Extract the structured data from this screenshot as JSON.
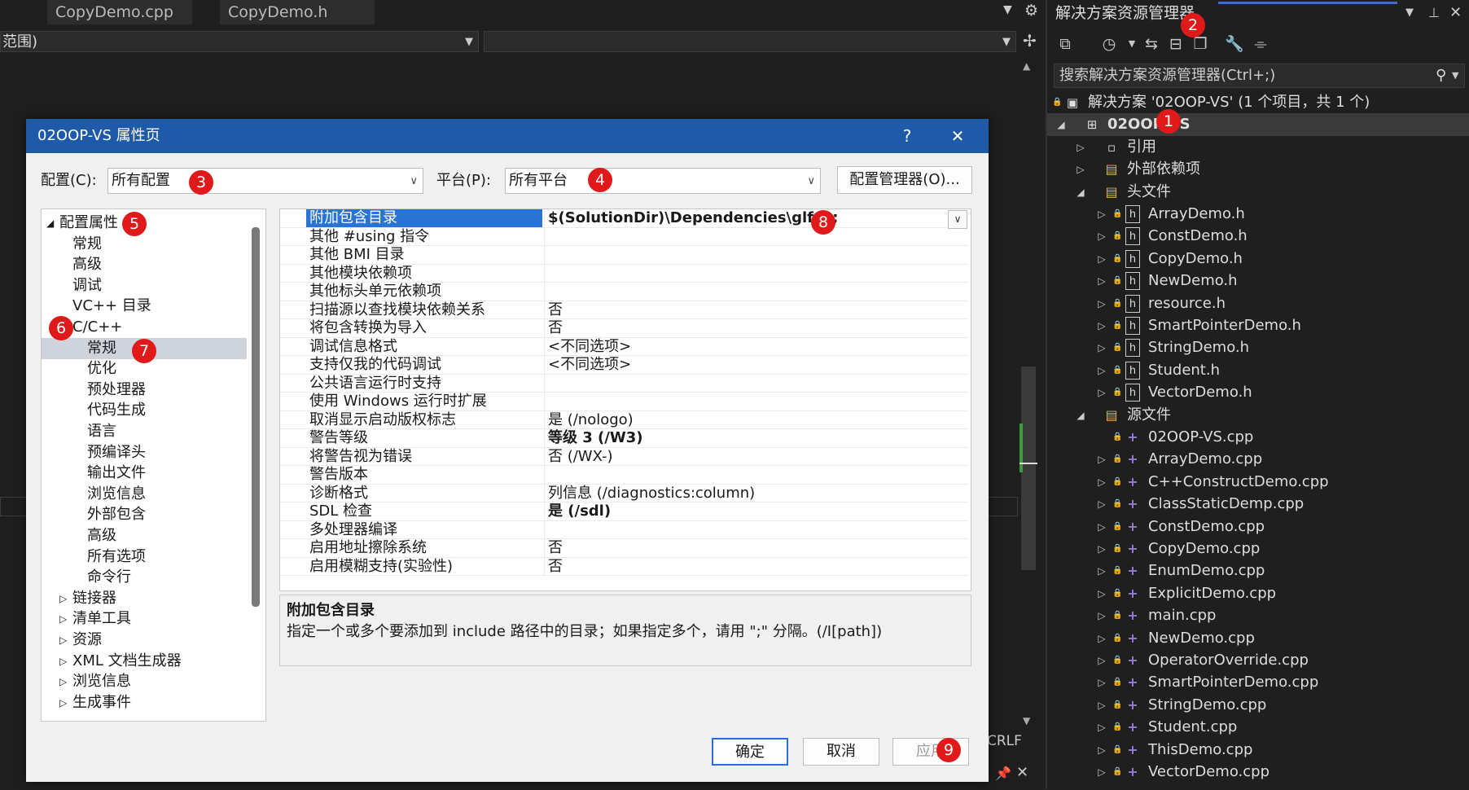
{
  "editor": {
    "tabs": [
      "CopyDemo.cpp",
      "CopyDemo.h"
    ],
    "nav_scope": "范围)",
    "crlf": "CRLF"
  },
  "solution_explorer": {
    "title": "解决方案资源管理器",
    "search_placeholder": "搜索解决方案资源管理器(Ctrl+;)",
    "solution_label": "解决方案 '02OOP-VS' (1 个项目，共 1 个)",
    "project": "02OOP-VS",
    "references": "引用",
    "external_deps": "外部依赖项",
    "headers_folder": "头文件",
    "headers": [
      "ArrayDemo.h",
      "ConstDemo.h",
      "CopyDemo.h",
      "NewDemo.h",
      "resource.h",
      "SmartPointerDemo.h",
      "StringDemo.h",
      "Student.h",
      "VectorDemo.h"
    ],
    "sources_folder": "源文件",
    "sources": [
      "02OOP-VS.cpp",
      "ArrayDemo.cpp",
      "C++ConstructDemo.cpp",
      "ClassStaticDemp.cpp",
      "ConstDemo.cpp",
      "CopyDemo.cpp",
      "EnumDemo.cpp",
      "ExplicitDemo.cpp",
      "main.cpp",
      "NewDemo.cpp",
      "OperatorOverride.cpp",
      "SmartPointerDemo.cpp",
      "StringDemo.cpp",
      "Student.cpp",
      "ThisDemo.cpp",
      "VectorDemo.cpp"
    ]
  },
  "dialog": {
    "title": "02OOP-VS 属性页",
    "help": "?",
    "close": "✕",
    "config_label": "配置(C):",
    "config_value": "所有配置",
    "platform_label": "平台(P):",
    "platform_value": "所有平台",
    "config_manager": "配置管理器(O)...",
    "tree": {
      "root": "配置属性",
      "items": [
        "常规",
        "高级",
        "调试",
        "VC++ 目录"
      ],
      "cpp": "C/C++",
      "cpp_children": [
        "常规",
        "优化",
        "预处理器",
        "代码生成",
        "语言",
        "预编译头",
        "输出文件",
        "浏览信息",
        "外部包含",
        "高级",
        "所有选项",
        "命令行"
      ],
      "collapsed": [
        "链接器",
        "清单工具",
        "资源",
        "XML 文档生成器",
        "浏览信息",
        "生成事件"
      ]
    },
    "properties": [
      {
        "name": "附加包含目录",
        "value": "$(SolutionDir)\\Dependencies\\glfw\\;"
      },
      {
        "name": "其他 #using 指令",
        "value": ""
      },
      {
        "name": "其他 BMI 目录",
        "value": ""
      },
      {
        "name": "其他模块依赖项",
        "value": ""
      },
      {
        "name": "其他标头单元依赖项",
        "value": ""
      },
      {
        "name": "扫描源以查找模块依赖关系",
        "value": "否"
      },
      {
        "name": "将包含转换为导入",
        "value": "否"
      },
      {
        "name": "调试信息格式",
        "value": "<不同选项>"
      },
      {
        "name": "支持仅我的代码调试",
        "value": "<不同选项>"
      },
      {
        "name": "公共语言运行时支持",
        "value": ""
      },
      {
        "name": "使用 Windows 运行时扩展",
        "value": ""
      },
      {
        "name": "取消显示启动版权标志",
        "value": "是 (/nologo)"
      },
      {
        "name": "警告等级",
        "value": "等级 3 (/W3)"
      },
      {
        "name": "将警告视为错误",
        "value": "否 (/WX-)"
      },
      {
        "name": "警告版本",
        "value": ""
      },
      {
        "name": "诊断格式",
        "value": "列信息 (/diagnostics:column)"
      },
      {
        "name": "SDL 检查",
        "value": "是 (/sdl)"
      },
      {
        "name": "多处理器编译",
        "value": ""
      },
      {
        "name": "启用地址擦除系统",
        "value": "否"
      },
      {
        "name": "启用模糊支持(实验性)",
        "value": "否"
      }
    ],
    "desc_title": "附加包含目录",
    "desc_text": "指定一个或多个要添加到 include 路径中的目录；如果指定多个，请用 \";\" 分隔。(/I[path])",
    "ok": "确定",
    "cancel": "取消",
    "apply": "应用"
  },
  "badges": [
    "1",
    "2",
    "3",
    "4",
    "5",
    "6",
    "7",
    "8",
    "9"
  ],
  "colors": {
    "accent": "#1f5aa8",
    "badge": "#e01a1a",
    "selection": "#2a73d6"
  }
}
